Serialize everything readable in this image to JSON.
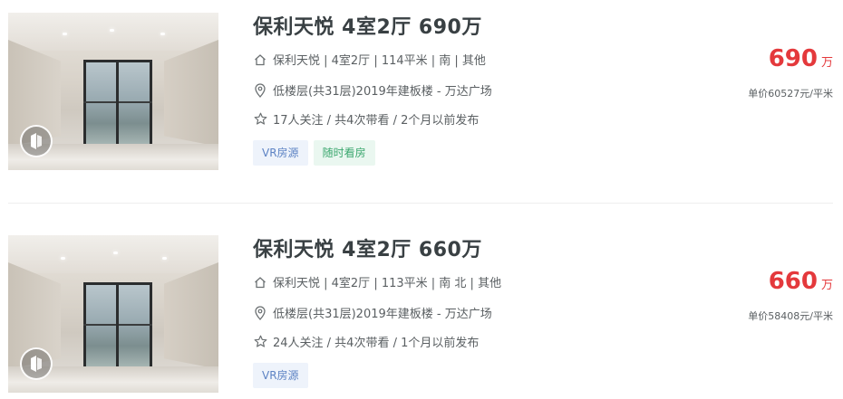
{
  "listings": [
    {
      "title": "保利天悦 4室2厅 690万",
      "house_info": "保利天悦 | 4室2厅 | 114平米 | 南 | 其他",
      "position_info": "低楼层(共31层)2019年建板楼 - 万达广场",
      "follow_info": "17人关注 / 共4次带看 / 2个月以前发布",
      "tags": [
        "VR房源",
        "随时看房"
      ],
      "total_price": "690",
      "price_unit": "万",
      "unit_price": "单价60527元/平米"
    },
    {
      "title": "保利天悦 4室2厅 660万",
      "house_info": "保利天悦 | 4室2厅 | 113平米 | 南 北 | 其他",
      "position_info": "低楼层(共31层)2019年建板楼 - 万达广场",
      "follow_info": "24人关注 / 共4次带看 / 1个月以前发布",
      "tags": [
        "VR房源"
      ],
      "total_price": "660",
      "price_unit": "万",
      "unit_price": "单价58408元/平米"
    }
  ],
  "colors": {
    "price": "#e4393c",
    "title": "#394043",
    "tag_vr_text": "#5d83c4",
    "tag_vr_bg": "#eef3fb",
    "tag_anytime_text": "#3ba76e",
    "tag_anytime_bg": "#eaf7f0"
  },
  "icons": {
    "house": "house-icon",
    "position": "location-pin-icon",
    "follow": "star-icon",
    "vr": "vr-badge-icon"
  }
}
